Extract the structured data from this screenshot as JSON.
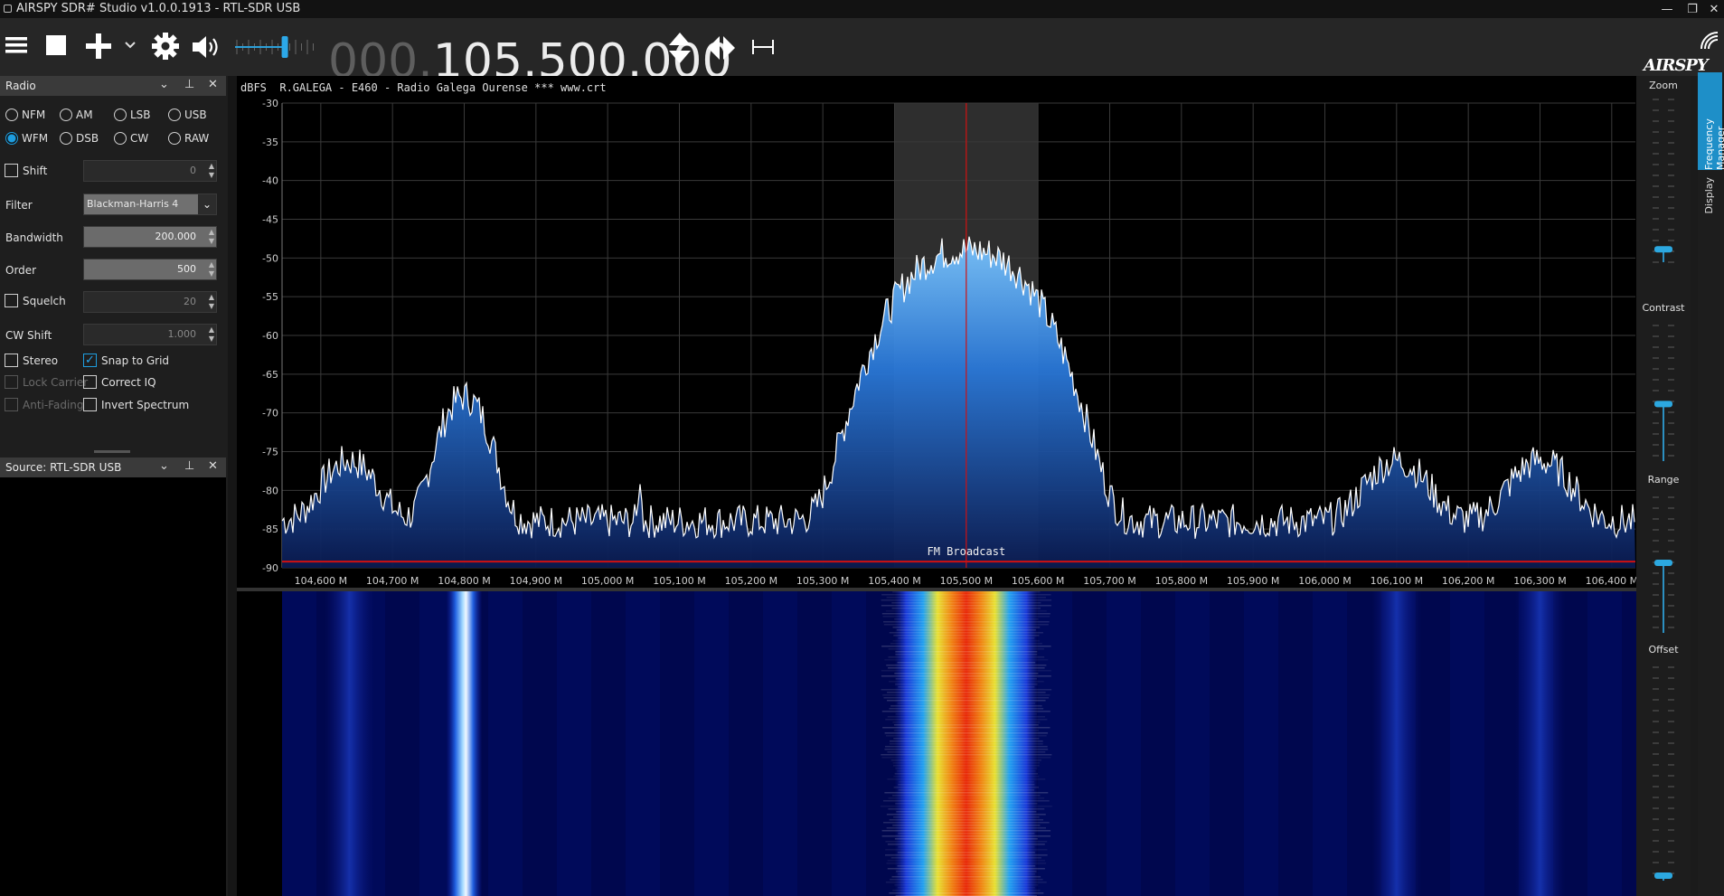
{
  "window": {
    "title": "AIRSPY SDR# Studio v1.0.0.1913 - RTL-SDR USB",
    "controls": [
      "minimize",
      "restore",
      "close"
    ]
  },
  "toolbar": {
    "menu_icon": "hamburger-menu-icon",
    "stop_icon": "stop-square-icon",
    "add_icon": "plus-icon",
    "settings_icon": "gear-icon",
    "audio_icon": "speaker-icon",
    "volume_level": 0.62,
    "freq_dim": "000.",
    "freq_main": "105.500.000",
    "logo_text": "AIRSPY"
  },
  "radio_panel": {
    "title": "Radio",
    "modes_row1": [
      "NFM",
      "AM",
      "LSB",
      "USB"
    ],
    "modes_row2": [
      "WFM",
      "DSB",
      "CW",
      "RAW"
    ],
    "selected_mode": "WFM",
    "shift": {
      "label": "Shift",
      "value": "0",
      "checked": false
    },
    "filter": {
      "label": "Filter",
      "value": "Blackman-Harris 4"
    },
    "bandwidth": {
      "label": "Bandwidth",
      "value": "200.000"
    },
    "order": {
      "label": "Order",
      "value": "500"
    },
    "squelch": {
      "label": "Squelch",
      "value": "20",
      "checked": false
    },
    "cw_shift": {
      "label": "CW Shift",
      "value": "1.000"
    },
    "checkboxes": {
      "stereo": {
        "label": "Stereo",
        "checked": false
      },
      "snap_to_grid": {
        "label": "Snap to Grid",
        "checked": true
      },
      "lock_carrier": {
        "label": "Lock Carrier",
        "checked": false,
        "disabled": true
      },
      "correct_iq": {
        "label": "Correct IQ",
        "checked": false
      },
      "anti_fading": {
        "label": "Anti-Fading",
        "checked": false,
        "disabled": true
      },
      "invert_spectrum": {
        "label": "Invert Spectrum",
        "checked": false
      }
    }
  },
  "source_panel": {
    "title": "Source: RTL-SDR USB"
  },
  "spectrum": {
    "unit": "dBFS",
    "rds_text": "R.GALEGA - E460 - Radio Galega Ourense *** www.crt",
    "band_label": "FM Broadcast",
    "y_ticks": [
      "-30",
      "-35",
      "-40",
      "-45",
      "-50",
      "-55",
      "-60",
      "-65",
      "-70",
      "-75",
      "-80",
      "-85",
      "-90"
    ],
    "x_ticks": [
      "104,600 M",
      "104,700 M",
      "104,800 M",
      "104,900 M",
      "105,000 M",
      "105,100 M",
      "105,200 M",
      "105,300 M",
      "105,400 M",
      "105,500 M",
      "105,600 M",
      "105,700 M",
      "105,800 M",
      "105,900 M",
      "106,000 M",
      "106,100 M",
      "106,200 M",
      "106,300 M",
      "106,400 M"
    ],
    "center_freq_mhz": 105.5,
    "filter_bandwidth_khz": 200,
    "peaks_dbfs": [
      {
        "freq_mhz": 104.64,
        "level": -77
      },
      {
        "freq_mhz": 104.8,
        "level": -68
      },
      {
        "freq_mhz": 105.5,
        "level": -49
      },
      {
        "freq_mhz": 106.1,
        "level": -77
      },
      {
        "freq_mhz": 106.3,
        "level": -77
      }
    ],
    "noise_floor_dbfs": -84
  },
  "right_controls": {
    "zoom": {
      "label": "Zoom",
      "level": 0.05
    },
    "contrast": {
      "label": "Contrast",
      "level": 0.4
    },
    "range": {
      "label": "Range",
      "level": 0.5
    },
    "offset": {
      "label": "Offset",
      "level": 0.0
    }
  },
  "side_tabs": [
    "Frequency Manager",
    "Display"
  ],
  "colors": {
    "accent": "#1e9ee0",
    "spectrum_line": "#ffffff",
    "center_line": "#d01010",
    "band_line": "#d01010"
  }
}
